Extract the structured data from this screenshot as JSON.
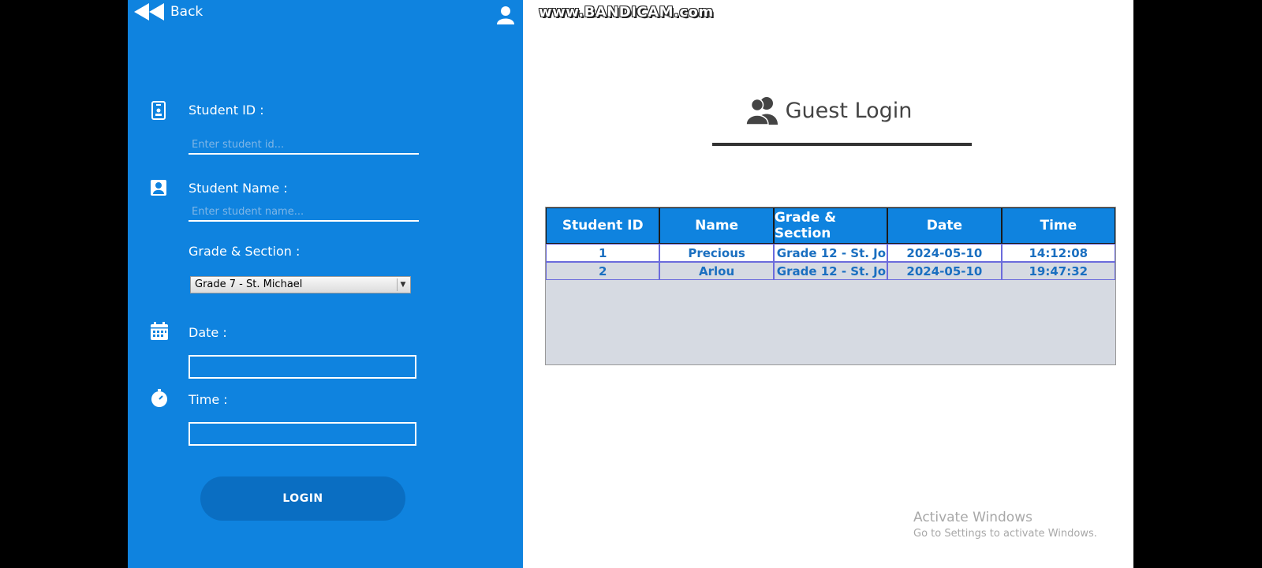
{
  "watermark": "www.BANDICAM.com",
  "left_panel": {
    "back_label": "Back",
    "student_id_label": "Student ID :",
    "student_id_placeholder": "Enter student id...",
    "student_name_label": "Student Name :",
    "student_name_placeholder": "Enter student name...",
    "grade_label": "Grade & Section :",
    "grade_selected": "Grade 7 - St. Michael",
    "date_label": "Date :",
    "time_label": "Time :",
    "login_label": "LOGIN"
  },
  "right_panel": {
    "title": "Guest Login",
    "table": {
      "headers": [
        "Student ID",
        "Name",
        "Grade & Section",
        "Date",
        "Time"
      ],
      "rows": [
        [
          "1",
          "Precious",
          "Grade 12 - St. Jo...",
          "2024-05-10",
          "14:12:08"
        ],
        [
          "2",
          "Arlou",
          "Grade 12 - St. Jo...",
          "2024-05-10",
          "19:47:32"
        ]
      ]
    }
  },
  "activate_windows": {
    "title": "Activate Windows",
    "subtitle": "Go to Settings to activate Windows."
  },
  "colors": {
    "panel_blue": "#0f83df",
    "button_blue": "#0a6ec2",
    "table_text": "#1a6fc0",
    "table_bg": "#d6dae2"
  }
}
